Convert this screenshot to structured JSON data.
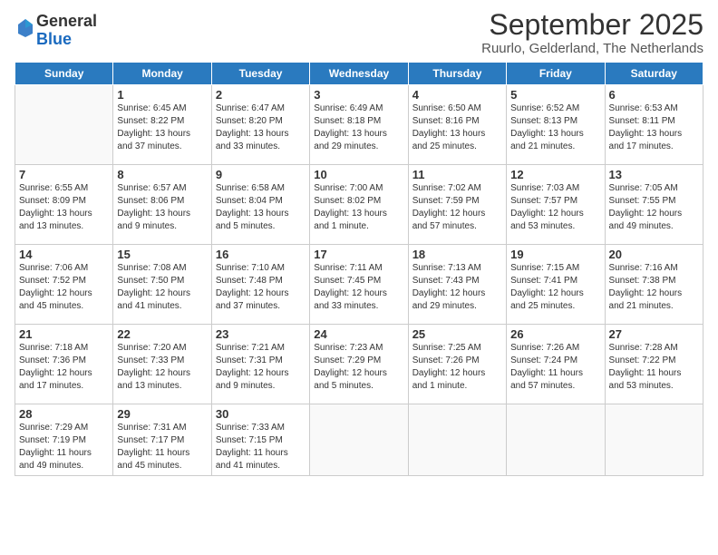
{
  "logo": {
    "general": "General",
    "blue": "Blue"
  },
  "header": {
    "month": "September 2025",
    "location": "Ruurlo, Gelderland, The Netherlands"
  },
  "days_of_week": [
    "Sunday",
    "Monday",
    "Tuesday",
    "Wednesday",
    "Thursday",
    "Friday",
    "Saturday"
  ],
  "weeks": [
    [
      {
        "day": "",
        "info": ""
      },
      {
        "day": "1",
        "info": "Sunrise: 6:45 AM\nSunset: 8:22 PM\nDaylight: 13 hours\nand 37 minutes."
      },
      {
        "day": "2",
        "info": "Sunrise: 6:47 AM\nSunset: 8:20 PM\nDaylight: 13 hours\nand 33 minutes."
      },
      {
        "day": "3",
        "info": "Sunrise: 6:49 AM\nSunset: 8:18 PM\nDaylight: 13 hours\nand 29 minutes."
      },
      {
        "day": "4",
        "info": "Sunrise: 6:50 AM\nSunset: 8:16 PM\nDaylight: 13 hours\nand 25 minutes."
      },
      {
        "day": "5",
        "info": "Sunrise: 6:52 AM\nSunset: 8:13 PM\nDaylight: 13 hours\nand 21 minutes."
      },
      {
        "day": "6",
        "info": "Sunrise: 6:53 AM\nSunset: 8:11 PM\nDaylight: 13 hours\nand 17 minutes."
      }
    ],
    [
      {
        "day": "7",
        "info": "Sunrise: 6:55 AM\nSunset: 8:09 PM\nDaylight: 13 hours\nand 13 minutes."
      },
      {
        "day": "8",
        "info": "Sunrise: 6:57 AM\nSunset: 8:06 PM\nDaylight: 13 hours\nand 9 minutes."
      },
      {
        "day": "9",
        "info": "Sunrise: 6:58 AM\nSunset: 8:04 PM\nDaylight: 13 hours\nand 5 minutes."
      },
      {
        "day": "10",
        "info": "Sunrise: 7:00 AM\nSunset: 8:02 PM\nDaylight: 13 hours\nand 1 minute."
      },
      {
        "day": "11",
        "info": "Sunrise: 7:02 AM\nSunset: 7:59 PM\nDaylight: 12 hours\nand 57 minutes."
      },
      {
        "day": "12",
        "info": "Sunrise: 7:03 AM\nSunset: 7:57 PM\nDaylight: 12 hours\nand 53 minutes."
      },
      {
        "day": "13",
        "info": "Sunrise: 7:05 AM\nSunset: 7:55 PM\nDaylight: 12 hours\nand 49 minutes."
      }
    ],
    [
      {
        "day": "14",
        "info": "Sunrise: 7:06 AM\nSunset: 7:52 PM\nDaylight: 12 hours\nand 45 minutes."
      },
      {
        "day": "15",
        "info": "Sunrise: 7:08 AM\nSunset: 7:50 PM\nDaylight: 12 hours\nand 41 minutes."
      },
      {
        "day": "16",
        "info": "Sunrise: 7:10 AM\nSunset: 7:48 PM\nDaylight: 12 hours\nand 37 minutes."
      },
      {
        "day": "17",
        "info": "Sunrise: 7:11 AM\nSunset: 7:45 PM\nDaylight: 12 hours\nand 33 minutes."
      },
      {
        "day": "18",
        "info": "Sunrise: 7:13 AM\nSunset: 7:43 PM\nDaylight: 12 hours\nand 29 minutes."
      },
      {
        "day": "19",
        "info": "Sunrise: 7:15 AM\nSunset: 7:41 PM\nDaylight: 12 hours\nand 25 minutes."
      },
      {
        "day": "20",
        "info": "Sunrise: 7:16 AM\nSunset: 7:38 PM\nDaylight: 12 hours\nand 21 minutes."
      }
    ],
    [
      {
        "day": "21",
        "info": "Sunrise: 7:18 AM\nSunset: 7:36 PM\nDaylight: 12 hours\nand 17 minutes."
      },
      {
        "day": "22",
        "info": "Sunrise: 7:20 AM\nSunset: 7:33 PM\nDaylight: 12 hours\nand 13 minutes."
      },
      {
        "day": "23",
        "info": "Sunrise: 7:21 AM\nSunset: 7:31 PM\nDaylight: 12 hours\nand 9 minutes."
      },
      {
        "day": "24",
        "info": "Sunrise: 7:23 AM\nSunset: 7:29 PM\nDaylight: 12 hours\nand 5 minutes."
      },
      {
        "day": "25",
        "info": "Sunrise: 7:25 AM\nSunset: 7:26 PM\nDaylight: 12 hours\nand 1 minute."
      },
      {
        "day": "26",
        "info": "Sunrise: 7:26 AM\nSunset: 7:24 PM\nDaylight: 11 hours\nand 57 minutes."
      },
      {
        "day": "27",
        "info": "Sunrise: 7:28 AM\nSunset: 7:22 PM\nDaylight: 11 hours\nand 53 minutes."
      }
    ],
    [
      {
        "day": "28",
        "info": "Sunrise: 7:29 AM\nSunset: 7:19 PM\nDaylight: 11 hours\nand 49 minutes."
      },
      {
        "day": "29",
        "info": "Sunrise: 7:31 AM\nSunset: 7:17 PM\nDaylight: 11 hours\nand 45 minutes."
      },
      {
        "day": "30",
        "info": "Sunrise: 7:33 AM\nSunset: 7:15 PM\nDaylight: 11 hours\nand 41 minutes."
      },
      {
        "day": "",
        "info": ""
      },
      {
        "day": "",
        "info": ""
      },
      {
        "day": "",
        "info": ""
      },
      {
        "day": "",
        "info": ""
      }
    ]
  ]
}
